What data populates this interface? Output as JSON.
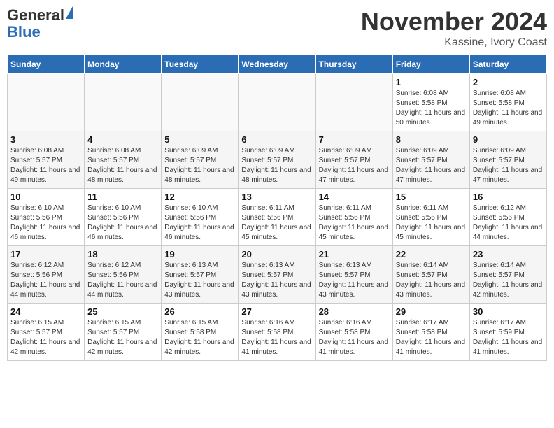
{
  "logo": {
    "line1": "General",
    "line2": "Blue"
  },
  "title": "November 2024",
  "location": "Kassine, Ivory Coast",
  "days_of_week": [
    "Sunday",
    "Monday",
    "Tuesday",
    "Wednesday",
    "Thursday",
    "Friday",
    "Saturday"
  ],
  "weeks": [
    [
      {
        "day": "",
        "info": ""
      },
      {
        "day": "",
        "info": ""
      },
      {
        "day": "",
        "info": ""
      },
      {
        "day": "",
        "info": ""
      },
      {
        "day": "",
        "info": ""
      },
      {
        "day": "1",
        "info": "Sunrise: 6:08 AM\nSunset: 5:58 PM\nDaylight: 11 hours and 50 minutes."
      },
      {
        "day": "2",
        "info": "Sunrise: 6:08 AM\nSunset: 5:58 PM\nDaylight: 11 hours and 49 minutes."
      }
    ],
    [
      {
        "day": "3",
        "info": "Sunrise: 6:08 AM\nSunset: 5:57 PM\nDaylight: 11 hours and 49 minutes."
      },
      {
        "day": "4",
        "info": "Sunrise: 6:08 AM\nSunset: 5:57 PM\nDaylight: 11 hours and 48 minutes."
      },
      {
        "day": "5",
        "info": "Sunrise: 6:09 AM\nSunset: 5:57 PM\nDaylight: 11 hours and 48 minutes."
      },
      {
        "day": "6",
        "info": "Sunrise: 6:09 AM\nSunset: 5:57 PM\nDaylight: 11 hours and 48 minutes."
      },
      {
        "day": "7",
        "info": "Sunrise: 6:09 AM\nSunset: 5:57 PM\nDaylight: 11 hours and 47 minutes."
      },
      {
        "day": "8",
        "info": "Sunrise: 6:09 AM\nSunset: 5:57 PM\nDaylight: 11 hours and 47 minutes."
      },
      {
        "day": "9",
        "info": "Sunrise: 6:09 AM\nSunset: 5:57 PM\nDaylight: 11 hours and 47 minutes."
      }
    ],
    [
      {
        "day": "10",
        "info": "Sunrise: 6:10 AM\nSunset: 5:56 PM\nDaylight: 11 hours and 46 minutes."
      },
      {
        "day": "11",
        "info": "Sunrise: 6:10 AM\nSunset: 5:56 PM\nDaylight: 11 hours and 46 minutes."
      },
      {
        "day": "12",
        "info": "Sunrise: 6:10 AM\nSunset: 5:56 PM\nDaylight: 11 hours and 46 minutes."
      },
      {
        "day": "13",
        "info": "Sunrise: 6:11 AM\nSunset: 5:56 PM\nDaylight: 11 hours and 45 minutes."
      },
      {
        "day": "14",
        "info": "Sunrise: 6:11 AM\nSunset: 5:56 PM\nDaylight: 11 hours and 45 minutes."
      },
      {
        "day": "15",
        "info": "Sunrise: 6:11 AM\nSunset: 5:56 PM\nDaylight: 11 hours and 45 minutes."
      },
      {
        "day": "16",
        "info": "Sunrise: 6:12 AM\nSunset: 5:56 PM\nDaylight: 11 hours and 44 minutes."
      }
    ],
    [
      {
        "day": "17",
        "info": "Sunrise: 6:12 AM\nSunset: 5:56 PM\nDaylight: 11 hours and 44 minutes."
      },
      {
        "day": "18",
        "info": "Sunrise: 6:12 AM\nSunset: 5:56 PM\nDaylight: 11 hours and 44 minutes."
      },
      {
        "day": "19",
        "info": "Sunrise: 6:13 AM\nSunset: 5:57 PM\nDaylight: 11 hours and 43 minutes."
      },
      {
        "day": "20",
        "info": "Sunrise: 6:13 AM\nSunset: 5:57 PM\nDaylight: 11 hours and 43 minutes."
      },
      {
        "day": "21",
        "info": "Sunrise: 6:13 AM\nSunset: 5:57 PM\nDaylight: 11 hours and 43 minutes."
      },
      {
        "day": "22",
        "info": "Sunrise: 6:14 AM\nSunset: 5:57 PM\nDaylight: 11 hours and 43 minutes."
      },
      {
        "day": "23",
        "info": "Sunrise: 6:14 AM\nSunset: 5:57 PM\nDaylight: 11 hours and 42 minutes."
      }
    ],
    [
      {
        "day": "24",
        "info": "Sunrise: 6:15 AM\nSunset: 5:57 PM\nDaylight: 11 hours and 42 minutes."
      },
      {
        "day": "25",
        "info": "Sunrise: 6:15 AM\nSunset: 5:57 PM\nDaylight: 11 hours and 42 minutes."
      },
      {
        "day": "26",
        "info": "Sunrise: 6:15 AM\nSunset: 5:58 PM\nDaylight: 11 hours and 42 minutes."
      },
      {
        "day": "27",
        "info": "Sunrise: 6:16 AM\nSunset: 5:58 PM\nDaylight: 11 hours and 41 minutes."
      },
      {
        "day": "28",
        "info": "Sunrise: 6:16 AM\nSunset: 5:58 PM\nDaylight: 11 hours and 41 minutes."
      },
      {
        "day": "29",
        "info": "Sunrise: 6:17 AM\nSunset: 5:58 PM\nDaylight: 11 hours and 41 minutes."
      },
      {
        "day": "30",
        "info": "Sunrise: 6:17 AM\nSunset: 5:59 PM\nDaylight: 11 hours and 41 minutes."
      }
    ]
  ]
}
